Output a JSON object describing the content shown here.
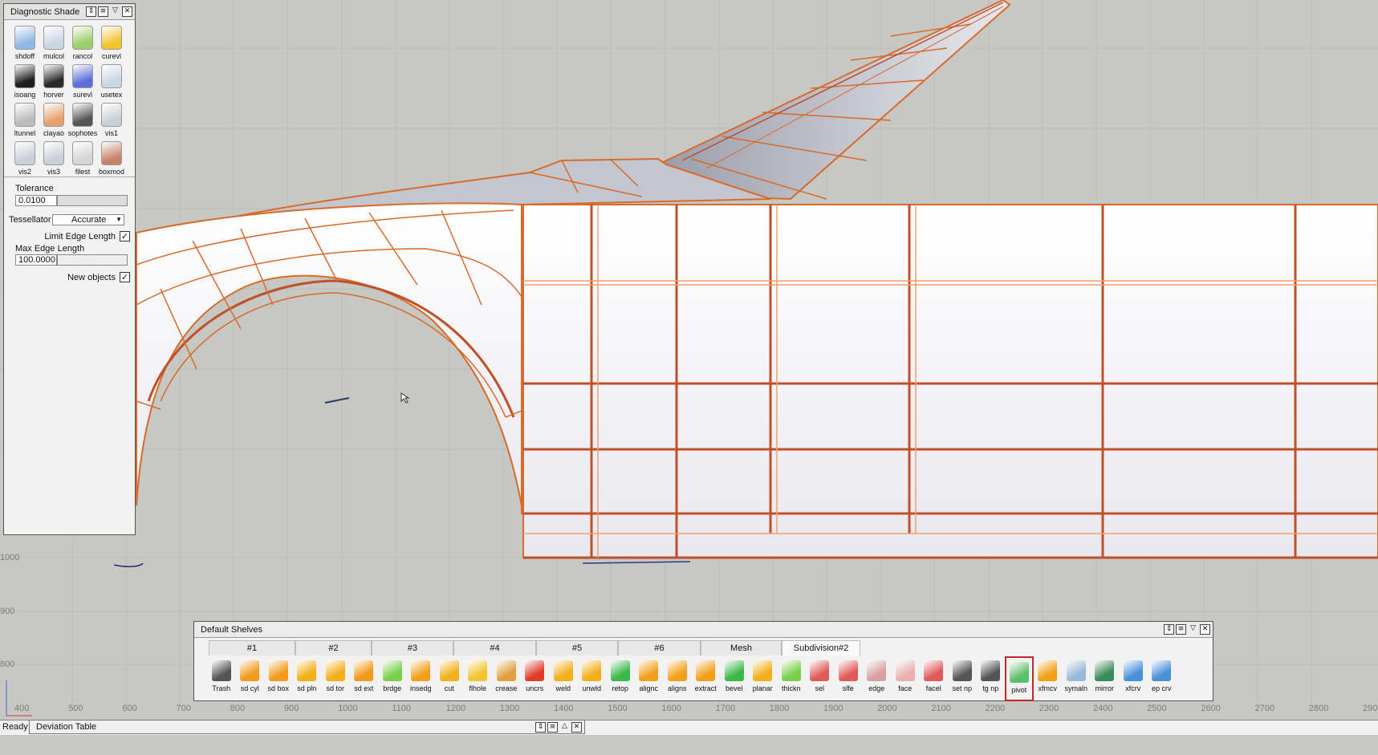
{
  "diagnostic_shade": {
    "title": "Diagnostic Shade",
    "icons": [
      {
        "label": "shdoff",
        "color": "#8fb8e6"
      },
      {
        "label": "mulcol",
        "color": "#c9d6e4"
      },
      {
        "label": "rancol",
        "color": "#9ad06a"
      },
      {
        "label": "curevl",
        "color": "#f2c42e"
      },
      {
        "label": "isoang",
        "color": "#1e1e1e"
      },
      {
        "label": "horver",
        "color": "#2a2a2a"
      },
      {
        "label": "surevl",
        "color": "#5a6fd8"
      },
      {
        "label": "usetex",
        "color": "#c9d6e4"
      },
      {
        "label": "ltunnel",
        "color": "#bcbcbc"
      },
      {
        "label": "clayao",
        "color": "#e8a06a"
      },
      {
        "label": "sophotes",
        "color": "#555555"
      },
      {
        "label": "vis1",
        "color": "#c9d0d8"
      },
      {
        "label": "vis2",
        "color": "#c9d0d8"
      },
      {
        "label": "vis3",
        "color": "#c9d0d8"
      },
      {
        "label": "filest",
        "color": "#d6d6d6"
      },
      {
        "label": "boxmod",
        "color": "#c8826a"
      }
    ],
    "tolerance_label": "Tolerance",
    "tolerance_value": "0.0100",
    "tessellator_label": "Tessellator",
    "tessellator_value": "Accurate",
    "limit_edge_label": "Limit Edge Length",
    "limit_edge_checked": "✓",
    "max_edge_label": "Max Edge Length",
    "max_edge_value": "100.0000",
    "new_objects_label": "New objects",
    "new_objects_checked": "✓"
  },
  "shelves": {
    "title": "Default Shelves",
    "tabs": [
      "#1",
      "#2",
      "#3",
      "#4",
      "#5",
      "#6",
      "Mesh",
      "Subdivision#2"
    ],
    "active_tab": "Subdivision#2",
    "tools": [
      {
        "label": "Trash",
        "color": "#555555"
      },
      {
        "label": "sd cyl",
        "color": "#f29a1a"
      },
      {
        "label": "sd box",
        "color": "#f29a1a"
      },
      {
        "label": "sd pln",
        "color": "#f2b01a"
      },
      {
        "label": "sd tor",
        "color": "#f2b01a"
      },
      {
        "label": "sd ext",
        "color": "#f29a1a"
      },
      {
        "label": "brdge",
        "color": "#7ad04a"
      },
      {
        "label": "insedg",
        "color": "#f2a01a"
      },
      {
        "label": "cut",
        "color": "#f2b01a"
      },
      {
        "label": "flhole",
        "color": "#f2c42e"
      },
      {
        "label": "crease",
        "color": "#e0a040"
      },
      {
        "label": "uncrs",
        "color": "#e03a2a"
      },
      {
        "label": "weld",
        "color": "#f2b01a"
      },
      {
        "label": "unwld",
        "color": "#f2b01a"
      },
      {
        "label": "retop",
        "color": "#3ab84a"
      },
      {
        "label": "alignc",
        "color": "#f2a01a"
      },
      {
        "label": "aligns",
        "color": "#f2a01a"
      },
      {
        "label": "extract",
        "color": "#f2a01a"
      },
      {
        "label": "bevel",
        "color": "#3ab84a"
      },
      {
        "label": "planar",
        "color": "#f2b01a"
      },
      {
        "label": "thickn",
        "color": "#7ad04a"
      },
      {
        "label": "sel",
        "color": "#e05a5a"
      },
      {
        "label": "slfe",
        "color": "#e05a5a"
      },
      {
        "label": "edge",
        "color": "#d8a0a0"
      },
      {
        "label": "face",
        "color": "#e8b0b0"
      },
      {
        "label": "facel",
        "color": "#e05a5a"
      },
      {
        "label": "set np",
        "color": "#555555"
      },
      {
        "label": "tg np",
        "color": "#555555"
      },
      {
        "label": "pivot",
        "color": "#5ac06a"
      },
      {
        "label": "xfmcv",
        "color": "#f2a01a"
      },
      {
        "label": "symaln",
        "color": "#9ab8d8"
      },
      {
        "label": "mirror",
        "color": "#3a8a5a"
      },
      {
        "label": "xfcrv",
        "color": "#4a90d8"
      },
      {
        "label": "ep crv",
        "color": "#4a90d8"
      }
    ],
    "selected_tool": "pivot"
  },
  "ruler": {
    "ticks": [
      "400",
      "500",
      "600",
      "700",
      "800",
      "900",
      "1000",
      "1100",
      "1200",
      "1300",
      "1400",
      "1500",
      "1600",
      "1700",
      "1800",
      "1900",
      "2000",
      "2100",
      "2200",
      "2300",
      "2400",
      "2500",
      "2600",
      "2700",
      "2800",
      "2900"
    ]
  },
  "side_ruler": [
    "1000",
    "900",
    "800"
  ],
  "status": {
    "text": "Ready"
  },
  "deviation_table": {
    "title": "Deviation Table"
  },
  "colors": {
    "wire": "#d86a2a",
    "wire_dark": "#b8502a",
    "surface": "#f4f4f6",
    "background": "#c7c8c3",
    "grid": "#bdbeb9"
  }
}
